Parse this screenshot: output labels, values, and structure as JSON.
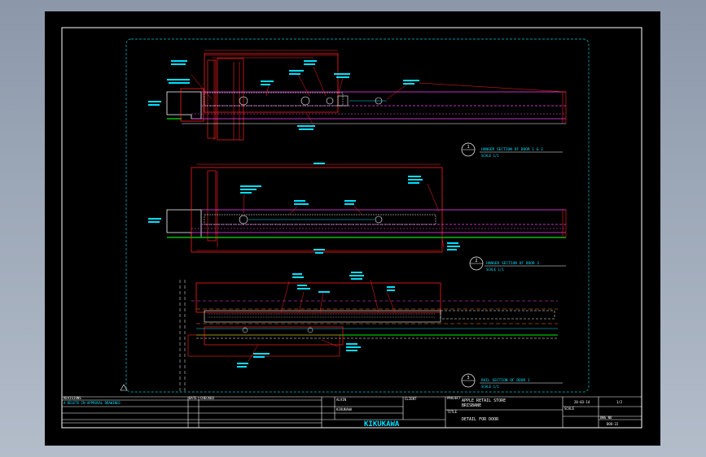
{
  "drawing": {
    "colors": {
      "background": "#000000",
      "border": "#ffffff",
      "dimension": "#ff2020",
      "annotation": "#00e0ff",
      "hidden": "#ff40ff",
      "floor": "#00c000",
      "outline": "#ffffff"
    }
  },
  "views": [
    {
      "circle_num": "1",
      "title": "HANGER SECTION OF DOOR 1 & 2",
      "scale": "SCALE 1/1"
    },
    {
      "circle_num": "2",
      "title": "HANGER SECTION OF DOOR 3",
      "scale": "SCALE 1/1"
    },
    {
      "circle_num": "3",
      "title": "RAIL SECTION OF DOOR 1",
      "scale": "SCALE 1/1"
    }
  ],
  "title_block": {
    "revisions_label": "REVISIONS",
    "revision_entry": "A  DELETE IN APPROVAL DRAWINGS",
    "date_label": "DATE",
    "checked_label": "CHECKED",
    "drawn_by": "ALVIN",
    "approved": "KIKUKAWA",
    "client_label": "CLIENT",
    "project_label": "PROJECT",
    "project_name": "APPLE RETAIL STORE",
    "project_sub": "BRISBANE",
    "title_label": "TITLE",
    "drawing_title": "DETAIL FOR DOOR",
    "company": "KIKUKAWA",
    "date_value": "20-03-14",
    "sheet_value": "1/2",
    "drawing_no": "DOO-22",
    "scale_label": "SCALE",
    "dwg_no_label": "DWG NO"
  }
}
